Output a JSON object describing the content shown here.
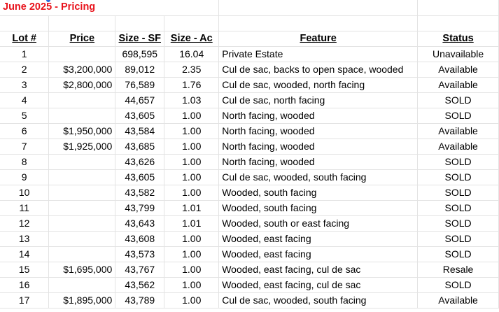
{
  "title": "June 2025 -  Pricing",
  "headers": {
    "lot": "Lot #",
    "price": "Price",
    "size_sf": "Size - SF",
    "size_ac": "Size - Ac",
    "feature": "Feature",
    "status": "Status"
  },
  "rows": [
    {
      "lot": "1",
      "price": "",
      "size_sf": "698,595",
      "size_ac": "16.04",
      "feature": "Private Estate",
      "status": "Unavailable"
    },
    {
      "lot": "2",
      "price": "$3,200,000",
      "size_sf": "89,012",
      "size_ac": "2.35",
      "feature": "Cul de sac, backs to open space, wooded",
      "status": "Available"
    },
    {
      "lot": "3",
      "price": "$2,800,000",
      "size_sf": "76,589",
      "size_ac": "1.76",
      "feature": "Cul de sac, wooded, north facing",
      "status": "Available"
    },
    {
      "lot": "4",
      "price": "",
      "size_sf": "44,657",
      "size_ac": "1.03",
      "feature": "Cul de sac, north facing",
      "status": "SOLD"
    },
    {
      "lot": "5",
      "price": "",
      "size_sf": "43,605",
      "size_ac": "1.00",
      "feature": "North facing, wooded",
      "status": "SOLD"
    },
    {
      "lot": "6",
      "price": "$1,950,000",
      "size_sf": "43,584",
      "size_ac": "1.00",
      "feature": "North facing, wooded",
      "status": "Available"
    },
    {
      "lot": "7",
      "price": "$1,925,000",
      "size_sf": "43,685",
      "size_ac": "1.00",
      "feature": "North facing, wooded",
      "status": "Available"
    },
    {
      "lot": "8",
      "price": "",
      "size_sf": "43,626",
      "size_ac": "1.00",
      "feature": "North facing, wooded",
      "status": "SOLD"
    },
    {
      "lot": "9",
      "price": "",
      "size_sf": "43,605",
      "size_ac": "1.00",
      "feature": "Cul de sac, wooded, south facing",
      "status": "SOLD"
    },
    {
      "lot": "10",
      "price": "",
      "size_sf": "43,582",
      "size_ac": "1.00",
      "feature": "Wooded, south facing",
      "status": "SOLD"
    },
    {
      "lot": "11",
      "price": "",
      "size_sf": "43,799",
      "size_ac": "1.01",
      "feature": "Wooded, south facing",
      "status": "SOLD"
    },
    {
      "lot": "12",
      "price": "",
      "size_sf": "43,643",
      "size_ac": "1.01",
      "feature": "Wooded, south or east facing",
      "status": "SOLD"
    },
    {
      "lot": "13",
      "price": "",
      "size_sf": "43,608",
      "size_ac": "1.00",
      "feature": "Wooded, east facing",
      "status": "SOLD"
    },
    {
      "lot": "14",
      "price": "",
      "size_sf": "43,573",
      "size_ac": "1.00",
      "feature": "Wooded, east facing",
      "status": "SOLD"
    },
    {
      "lot": "15",
      "price": "$1,695,000",
      "size_sf": "43,767",
      "size_ac": "1.00",
      "feature": "Wooded, east facing, cul de sac",
      "status": "Resale"
    },
    {
      "lot": "16",
      "price": "",
      "size_sf": "43,562",
      "size_ac": "1.00",
      "feature": "Wooded, east facing, cul de sac",
      "status": "SOLD"
    },
    {
      "lot": "17",
      "price": "$1,895,000",
      "size_sf": "43,789",
      "size_ac": "1.00",
      "feature": "Cul de sac, wooded, south facing",
      "status": "Available"
    }
  ],
  "colors": {
    "title": "#e8121b",
    "gridline": "#e3e3e3",
    "selection_dot": "#2f6ad9"
  }
}
